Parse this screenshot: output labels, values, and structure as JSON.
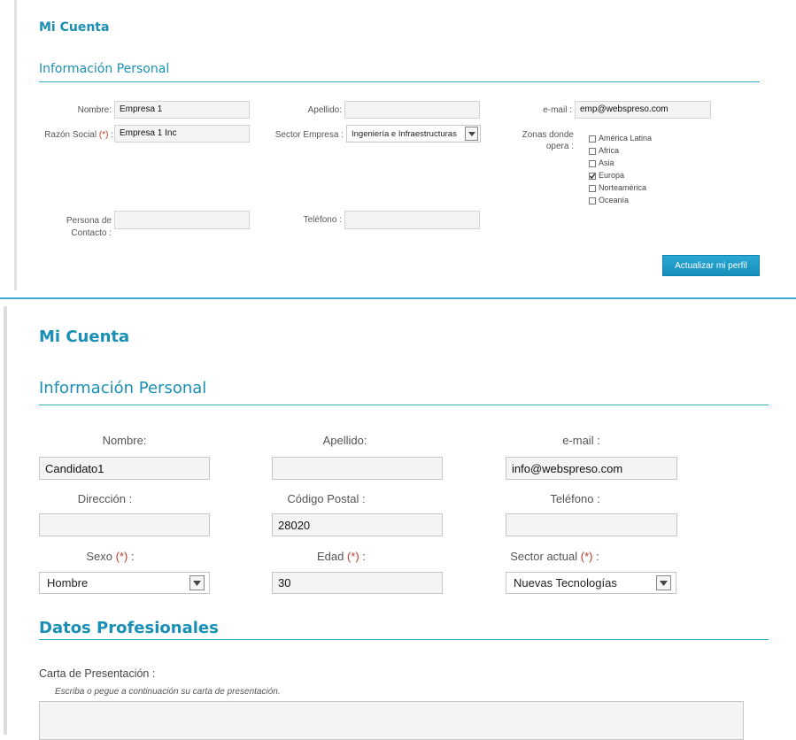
{
  "top": {
    "page_title": "Mi Cuenta",
    "section_title": "Información Personal",
    "labels": {
      "nombre": "Nombre:",
      "razon_social": "Razón Social",
      "razon_social_suffix": " :",
      "apellido": "Apellido:",
      "sector_empresa": "Sector Empresa :",
      "email": "e-mail :",
      "zonas_line1": "Zonas donde",
      "zonas_line2": "opera :",
      "persona_line1": "Persona de",
      "persona_line2": "Contacto :",
      "telefono": "Teléfono :",
      "required_mark": "(*)"
    },
    "values": {
      "nombre": "Empresa 1",
      "razon_social": "Empresa 1 Inc",
      "apellido": "",
      "sector_empresa": "Ingeniería e Infraestructuras",
      "email": "emp@webspreso.com",
      "persona": "",
      "telefono": ""
    },
    "zonas": [
      {
        "label": "América Latina",
        "checked": false
      },
      {
        "label": "Africa",
        "checked": false
      },
      {
        "label": "Asia",
        "checked": false
      },
      {
        "label": "Europa",
        "checked": true
      },
      {
        "label": "Norteamérica",
        "checked": false
      },
      {
        "label": "Oceanía",
        "checked": false
      }
    ],
    "button": "Actualizar mi perfil"
  },
  "bottom": {
    "page_title": "Mi Cuenta",
    "section_title": "Información Personal",
    "labels": {
      "nombre": "Nombre:",
      "apellido": "Apellido:",
      "email": "e-mail :",
      "direccion": "Dirección :",
      "codigo_postal": "Código Postal :",
      "telefono": "Teléfono :",
      "sexo": "Sexo",
      "edad": "Edad",
      "sector_actual": "Sector actual",
      "required_mark": "(*)",
      "colon": " :"
    },
    "values": {
      "nombre": "Candidato1",
      "apellido": "",
      "email": "info@webspreso.com",
      "direccion": "",
      "codigo_postal": "28020",
      "telefono": "",
      "sexo": "Hombre",
      "edad": "30",
      "sector_actual": "Nuevas Tecnologías"
    },
    "datos_title": "Datos Profesionales",
    "carta_label": "Carta de Presentación :",
    "carta_hint": "Escriba o pegue a continuación su carta de presentación.",
    "carta_value": ""
  },
  "colors": {
    "accent": "#1a8fb5",
    "rule": "#36a8cc",
    "required": "#c0392b",
    "button": "#1e9bc6"
  }
}
